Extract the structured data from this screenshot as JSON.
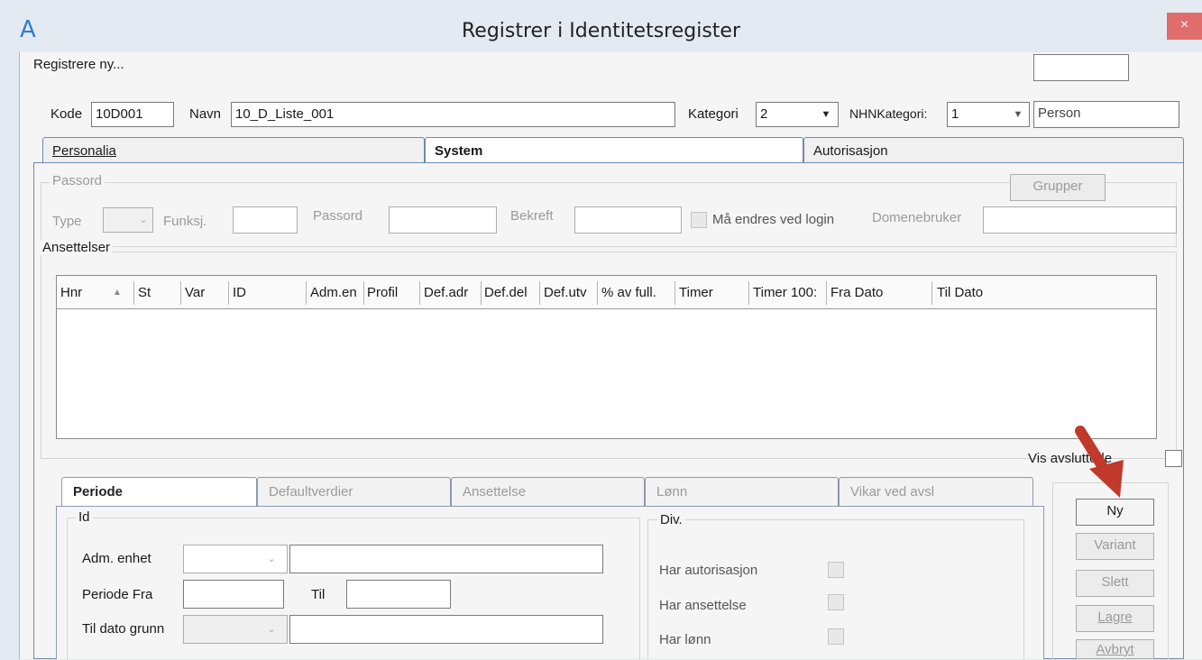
{
  "window": {
    "title": "Registrer i Identitetsregister",
    "app_icon": "A",
    "close_glyph": "×"
  },
  "header": {
    "mode_label": "Registrere ny...",
    "top_right_value": "",
    "kode_label": "Kode",
    "kode_value": "10D001",
    "navn_label": "Navn",
    "navn_value": "10_D_Liste_001",
    "kategori_label": "Kategori",
    "kategori_value": "2",
    "nhn_label": "NHNKategori:",
    "nhn_value": "1",
    "nhn_text": "Person"
  },
  "tabs": [
    {
      "label": "Personalia",
      "active": false
    },
    {
      "label": "System",
      "active": true
    },
    {
      "label": "Autorisasjon",
      "active": false
    }
  ],
  "passord": {
    "group_title": "Passord",
    "type_label": "Type",
    "funksj_label": "Funksj.",
    "passord_label": "Passord",
    "bekreft_label": "Bekreft",
    "endres_label": "Må endres ved login",
    "domenebruker_label": "Domenebruker",
    "grupper_button": "Grupper"
  },
  "ansettelser": {
    "group_title": "Ansettelser",
    "columns": [
      "Hnr",
      "St",
      "Var",
      "ID",
      "Adm.en",
      "Profil",
      "Def.adr",
      "Def.del",
      "Def.utv",
      "% av full.",
      "Timer",
      "Timer 100:",
      "Fra Dato",
      "Til Dato"
    ],
    "sort_indicator": "▲",
    "vis_avsluttede_label": "Vis avsluttede"
  },
  "subtabs": [
    {
      "label": "Periode",
      "active": true
    },
    {
      "label": "Defaultverdier",
      "active": false
    },
    {
      "label": "Ansettelse",
      "active": false
    },
    {
      "label": "Lønn",
      "active": false
    },
    {
      "label": "Vikar ved avsl",
      "active": false
    }
  ],
  "periode": {
    "id_group_title": "Id",
    "adm_enhet_label": "Adm. enhet",
    "periode_fra_label": "Periode  Fra",
    "til_label": "Til",
    "til_dato_grunn_label": "Til dato grunn"
  },
  "div": {
    "group_title": "Div.",
    "har_autorisasjon": "Har autorisasjon",
    "har_ansettelse": "Har ansettelse",
    "har_lonn": "Har lønn"
  },
  "side_buttons": {
    "ny": "Ny",
    "variant": "Variant",
    "slett": "Slett",
    "lagre": "Lagre",
    "avbryt": "Avbryt"
  },
  "colors": {
    "window_bg": "#e4eaf2",
    "annotation_arrow": "#c0392b"
  },
  "icons": {
    "app": "app-logo-icon",
    "close": "close-icon",
    "dropdown": "chevron-down-icon",
    "annotation": "red-arrow-annotation"
  }
}
